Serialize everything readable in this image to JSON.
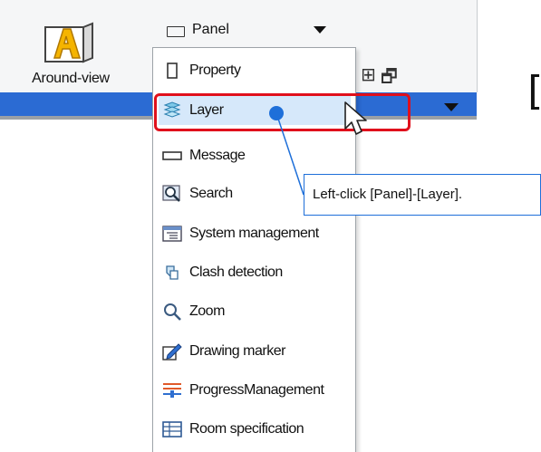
{
  "ribbon": {
    "around_view_label": "Around-view",
    "panel_label": "Panel"
  },
  "menu": {
    "items": [
      {
        "label": "Property",
        "icon": "property-icon"
      },
      {
        "label": "Layer",
        "icon": "layer-icon",
        "highlighted": true
      },
      {
        "label": "Message",
        "icon": "message-icon"
      },
      {
        "label": "Search",
        "icon": "search-icon"
      },
      {
        "label": "System management",
        "icon": "system-management-icon"
      },
      {
        "label": "Clash detection",
        "icon": "clash-detection-icon"
      },
      {
        "label": "Zoom",
        "icon": "zoom-icon"
      },
      {
        "label": "Drawing marker",
        "icon": "drawing-marker-icon"
      },
      {
        "label": "ProgressManagement",
        "icon": "progress-management-icon"
      },
      {
        "label": "Room specification",
        "icon": "room-specification-icon"
      }
    ]
  },
  "callout": {
    "text": "Left-click [Panel]-[Layer]."
  },
  "colors": {
    "accent_bar": "#2b6bd3",
    "highlight_box": "#e0101c",
    "callout_border": "#1e6fd9",
    "menu_highlight": "#d6e8fa"
  }
}
